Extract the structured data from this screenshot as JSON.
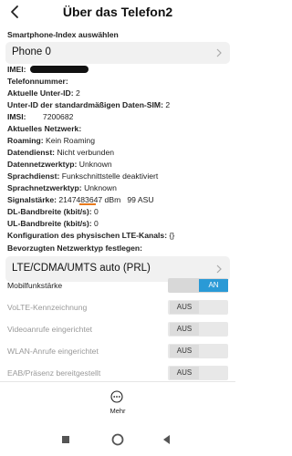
{
  "header": {
    "title": "Über das Telefon2"
  },
  "phone_index": {
    "label": "Smartphone-Index auswählen",
    "selected": "Phone 0"
  },
  "info": {
    "imei_label": "IMEI:",
    "phone_number_label": "Telefonnummer:",
    "sub_id_label": "Aktuelle Unter-ID:",
    "sub_id_value": "2",
    "default_sim_label": "Unter-ID der standardmäßigen Daten-SIM:",
    "default_sim_value": "2",
    "imsi_label": "IMSI:",
    "imsi_value": "7200682",
    "network_label": "Aktuelles Netzwerk:",
    "roaming_label": "Roaming:",
    "roaming_value": "Kein Roaming",
    "data_service_label": "Datendienst:",
    "data_service_value": "Nicht verbunden",
    "data_net_type_label": "Datennetzwerktyp:",
    "data_net_type_value": "Unknown",
    "voice_service_label": "Sprachdienst:",
    "voice_service_value": "Funkschnittstelle deaktiviert",
    "voice_net_type_label": "Sprachnetzwerktyp:",
    "voice_net_type_value": "Unknown",
    "signal_label": "Signalstärke:",
    "signal_value": "2147483647 dBm   99 ASU",
    "dl_label": "DL-Bandbreite (kbit/s):",
    "dl_value": "0",
    "ul_label": "UL-Bandbreite (kbit/s):",
    "ul_value": "0",
    "lte_config_label": "Konfiguration des physischen LTE-Kanals:",
    "lte_config_value": "{}"
  },
  "preferred_network": {
    "label": "Bevorzugten Netzwerktyp festlegen:",
    "selected": "LTE/CDMA/UMTS auto (PRL)"
  },
  "switches": [
    {
      "label": "Mobilfunkstärke",
      "state": "AN",
      "on": true
    },
    {
      "label": "VoLTE-Kennzeichnung",
      "state": "AUS",
      "on": false
    },
    {
      "label": "Videoanrufe eingerichtet",
      "state": "AUS",
      "on": false
    },
    {
      "label": "WLAN-Anrufe eingerichtet",
      "state": "AUS",
      "on": false
    },
    {
      "label": "EAB/Präsenz bereitgestellt",
      "state": "AUS",
      "on": false
    }
  ],
  "footer": {
    "more_label": "Mehr"
  },
  "colors": {
    "accent": "#2a9ad6",
    "underline": "#e8791b"
  }
}
